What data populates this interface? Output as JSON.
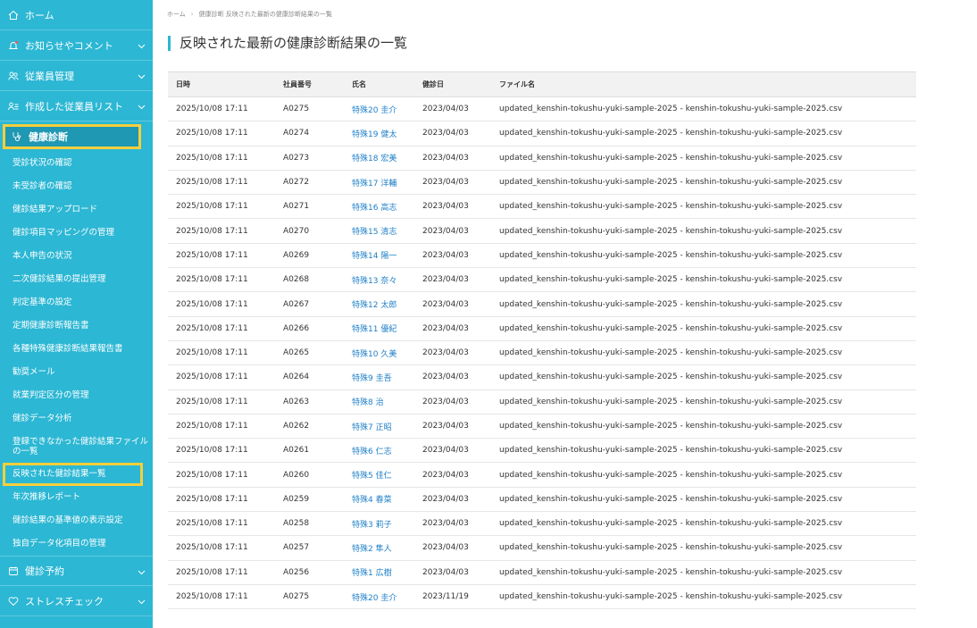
{
  "sidebar": {
    "home": "ホーム",
    "notices": "お知らせやコメント",
    "employees": "従業員管理",
    "created_list": "作成した従業員リスト",
    "health_check": "健康診断",
    "sub_items": [
      "受診状況の確認",
      "未受診者の確認",
      "健診結果アップロード",
      "健診項目マッピングの管理",
      "本人申告の状況",
      "二次健診結果の提出管理",
      "判定基準の設定",
      "定期健康診断報告書",
      "各種特殊健康診断結果報告書",
      "勧奨メール",
      "就業判定区分の管理",
      "健診データ分析",
      "登録できなかった健診結果ファイルの一覧",
      "反映された健診結果一覧",
      "年次推移レポート",
      "健診結果の基準値の表示設定",
      "独自データ化項目の管理"
    ],
    "reservation": "健診予約",
    "stress_check": "ストレスチェック"
  },
  "breadcrumb": {
    "home": "ホーム",
    "current": "健康診断 反映された最新の健康診断結果の一覧"
  },
  "page_title": "反映された最新の健康診断結果の一覧",
  "table": {
    "headers": [
      "日時",
      "社員番号",
      "氏名",
      "健診日",
      "ファイル名"
    ],
    "rows": [
      [
        "2025/10/08 17:11",
        "A0275",
        "特殊20 圭介",
        "2023/04/03",
        "updated_kenshin-tokushu-yuki-sample-2025 - kenshin-tokushu-yuki-sample-2025.csv"
      ],
      [
        "2025/10/08 17:11",
        "A0274",
        "特殊19 健太",
        "2023/04/03",
        "updated_kenshin-tokushu-yuki-sample-2025 - kenshin-tokushu-yuki-sample-2025.csv"
      ],
      [
        "2025/10/08 17:11",
        "A0273",
        "特殊18 宏美",
        "2023/04/03",
        "updated_kenshin-tokushu-yuki-sample-2025 - kenshin-tokushu-yuki-sample-2025.csv"
      ],
      [
        "2025/10/08 17:11",
        "A0272",
        "特殊17 洋輔",
        "2023/04/03",
        "updated_kenshin-tokushu-yuki-sample-2025 - kenshin-tokushu-yuki-sample-2025.csv"
      ],
      [
        "2025/10/08 17:11",
        "A0271",
        "特殊16 高志",
        "2023/04/03",
        "updated_kenshin-tokushu-yuki-sample-2025 - kenshin-tokushu-yuki-sample-2025.csv"
      ],
      [
        "2025/10/08 17:11",
        "A0270",
        "特殊15 清志",
        "2023/04/03",
        "updated_kenshin-tokushu-yuki-sample-2025 - kenshin-tokushu-yuki-sample-2025.csv"
      ],
      [
        "2025/10/08 17:11",
        "A0269",
        "特殊14 陽一",
        "2023/04/03",
        "updated_kenshin-tokushu-yuki-sample-2025 - kenshin-tokushu-yuki-sample-2025.csv"
      ],
      [
        "2025/10/08 17:11",
        "A0268",
        "特殊13 奈々",
        "2023/04/03",
        "updated_kenshin-tokushu-yuki-sample-2025 - kenshin-tokushu-yuki-sample-2025.csv"
      ],
      [
        "2025/10/08 17:11",
        "A0267",
        "特殊12 太郎",
        "2023/04/03",
        "updated_kenshin-tokushu-yuki-sample-2025 - kenshin-tokushu-yuki-sample-2025.csv"
      ],
      [
        "2025/10/08 17:11",
        "A0266",
        "特殊11 優紀",
        "2023/04/03",
        "updated_kenshin-tokushu-yuki-sample-2025 - kenshin-tokushu-yuki-sample-2025.csv"
      ],
      [
        "2025/10/08 17:11",
        "A0265",
        "特殊10 久美",
        "2023/04/03",
        "updated_kenshin-tokushu-yuki-sample-2025 - kenshin-tokushu-yuki-sample-2025.csv"
      ],
      [
        "2025/10/08 17:11",
        "A0264",
        "特殊9 圭吾",
        "2023/04/03",
        "updated_kenshin-tokushu-yuki-sample-2025 - kenshin-tokushu-yuki-sample-2025.csv"
      ],
      [
        "2025/10/08 17:11",
        "A0263",
        "特殊8 治",
        "2023/04/03",
        "updated_kenshin-tokushu-yuki-sample-2025 - kenshin-tokushu-yuki-sample-2025.csv"
      ],
      [
        "2025/10/08 17:11",
        "A0262",
        "特殊7 正昭",
        "2023/04/03",
        "updated_kenshin-tokushu-yuki-sample-2025 - kenshin-tokushu-yuki-sample-2025.csv"
      ],
      [
        "2025/10/08 17:11",
        "A0261",
        "特殊6 仁志",
        "2023/04/03",
        "updated_kenshin-tokushu-yuki-sample-2025 - kenshin-tokushu-yuki-sample-2025.csv"
      ],
      [
        "2025/10/08 17:11",
        "A0260",
        "特殊5 佳仁",
        "2023/04/03",
        "updated_kenshin-tokushu-yuki-sample-2025 - kenshin-tokushu-yuki-sample-2025.csv"
      ],
      [
        "2025/10/08 17:11",
        "A0259",
        "特殊4 春菜",
        "2023/04/03",
        "updated_kenshin-tokushu-yuki-sample-2025 - kenshin-tokushu-yuki-sample-2025.csv"
      ],
      [
        "2025/10/08 17:11",
        "A0258",
        "特殊3 莉子",
        "2023/04/03",
        "updated_kenshin-tokushu-yuki-sample-2025 - kenshin-tokushu-yuki-sample-2025.csv"
      ],
      [
        "2025/10/08 17:11",
        "A0257",
        "特殊2 隼人",
        "2023/04/03",
        "updated_kenshin-tokushu-yuki-sample-2025 - kenshin-tokushu-yuki-sample-2025.csv"
      ],
      [
        "2025/10/08 17:11",
        "A0256",
        "特殊1 広樹",
        "2023/04/03",
        "updated_kenshin-tokushu-yuki-sample-2025 - kenshin-tokushu-yuki-sample-2025.csv"
      ],
      [
        "2025/10/08 17:11",
        "A0275",
        "特殊20 圭介",
        "2023/11/19",
        "updated_kenshin-tokushu-yuki-sample-2025 - kenshin-tokushu-yuki-sample-2025.csv"
      ]
    ]
  },
  "colors": {
    "sidebar_bg": "#2cb7d4",
    "sidebar_active_bg": "#1f98b3",
    "highlight_border": "#f5cf3c",
    "link": "#1e7fc8"
  }
}
